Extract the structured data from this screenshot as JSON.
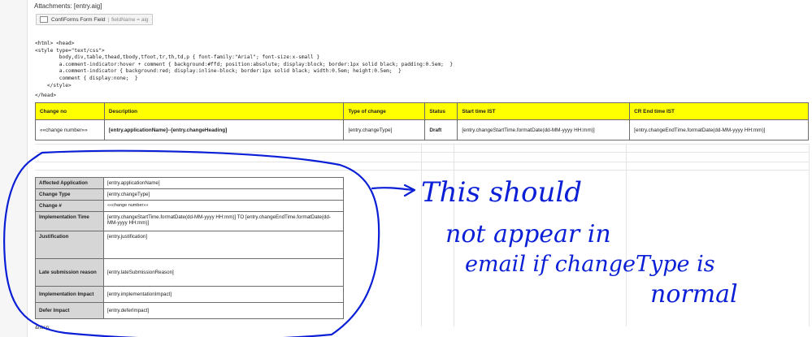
{
  "attachments_line": "Attachments: [entry.aig]",
  "macro": {
    "label": "ConfiForms Form Field",
    "separator": "|",
    "param": "fieldName = aig"
  },
  "code_block": "<html> <head>\n<style type=\"text/css\">\n        body,div,table,thead,tbody,tfoot,tr,th,td,p { font-family:\"Arial\"; font-size:x-small }\n        a.comment-indicator:hover + comment { background:#ffd; position:absolute; display:block; border:1px solid black; padding:0.5em;  }\n        a.comment-indicator { background:red; display:inline-block; border:1px solid black; width:0.5em; height:0.5em;  }\n        comment { display:none;  }\n    </style>",
  "head_close": "</head>",
  "change_table": {
    "headers": [
      "Change no",
      "Description",
      "Type of change",
      "Status",
      "Start time IST",
      "CR End time IST"
    ],
    "row": [
      "««change number»»",
      "[entry.applicationName]--[entry.changeHeading]",
      "[entry.changeType]",
      "Draft",
      "[entry.changeStartTime.formatDate(dd-MM-yyyy HH:mm)]",
      "[entry.changeEndTime.formatDate(dd-MM-yyyy HH:mm)]"
    ]
  },
  "detail_table": {
    "rows": [
      {
        "label": "Affected Application",
        "value": "[entry.applicationName]"
      },
      {
        "label": "Change Type",
        "value": "[entry.changeType]"
      },
      {
        "label": "Change #",
        "value": "««change number»»"
      },
      {
        "label": "Implementation Time",
        "value": "[entry.changeStartTime.formatDate(dd-MM-yyyy HH:mm)] TO [entry.changeEndTime.formatDate(dd-MM-yyyy HH:mm)]"
      },
      {
        "label": "Justification",
        "value": "[entry.justification]"
      },
      {
        "label": "Late submission reason",
        "value": "[entry.lateSubmissionReason]"
      },
      {
        "label": "Implementation Impact",
        "value": "[entry.implementationImpact]"
      },
      {
        "label": "Defer Impact",
        "value": "[entry.deferImpact]"
      }
    ]
  },
  "trailing_text": "&nbsp;",
  "annotation": {
    "ink_color": "#0a1fd6",
    "line1": "This should",
    "line2": "not appear in",
    "line3": "email if changeType is",
    "line4": "normal"
  }
}
